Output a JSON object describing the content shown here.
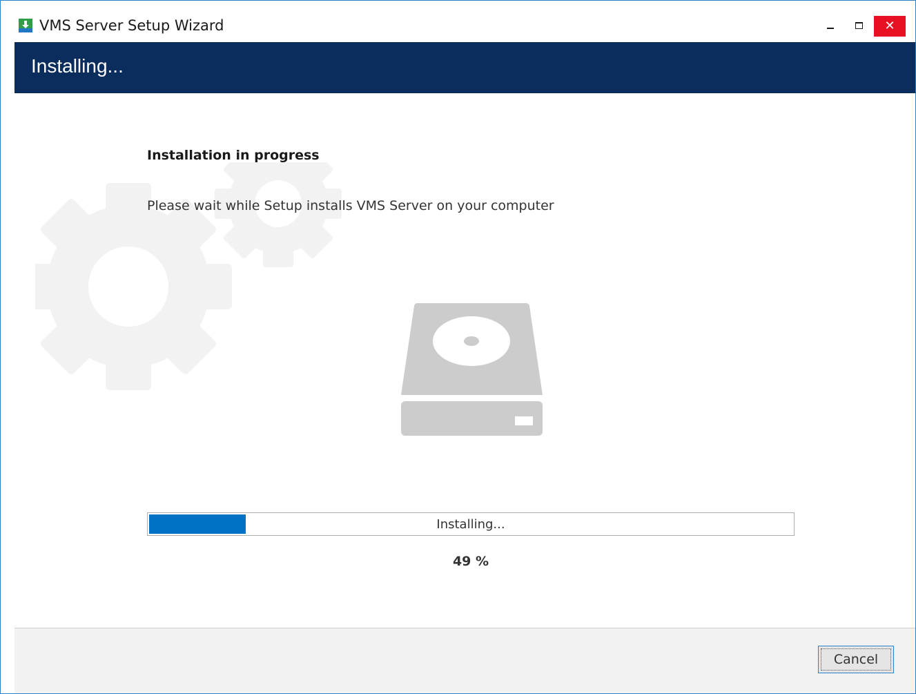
{
  "window": {
    "title": "VMS Server Setup Wizard",
    "controls": {
      "minimize": "minimize-icon",
      "maximize": "maximize-icon",
      "close": "close-icon",
      "close_glyph": "✕"
    }
  },
  "header": {
    "title": "Installing..."
  },
  "content": {
    "heading": "Installation in progress",
    "subtext": "Please wait while Setup installs VMS Server on your computer",
    "illustration": {
      "background": "gears-icon",
      "foreground": "hard-disk-icon"
    }
  },
  "progress": {
    "status_text": "Installing...",
    "percent_label": "49 %",
    "bar_fill_fraction": 0.15,
    "fill_color": "#0072c6"
  },
  "footer": {
    "cancel_label": "Cancel"
  },
  "colors": {
    "header_band": "#0b2d5e",
    "close_button": "#e81123",
    "window_border": "#2b80c8",
    "icon_gray": "#cccccc"
  }
}
